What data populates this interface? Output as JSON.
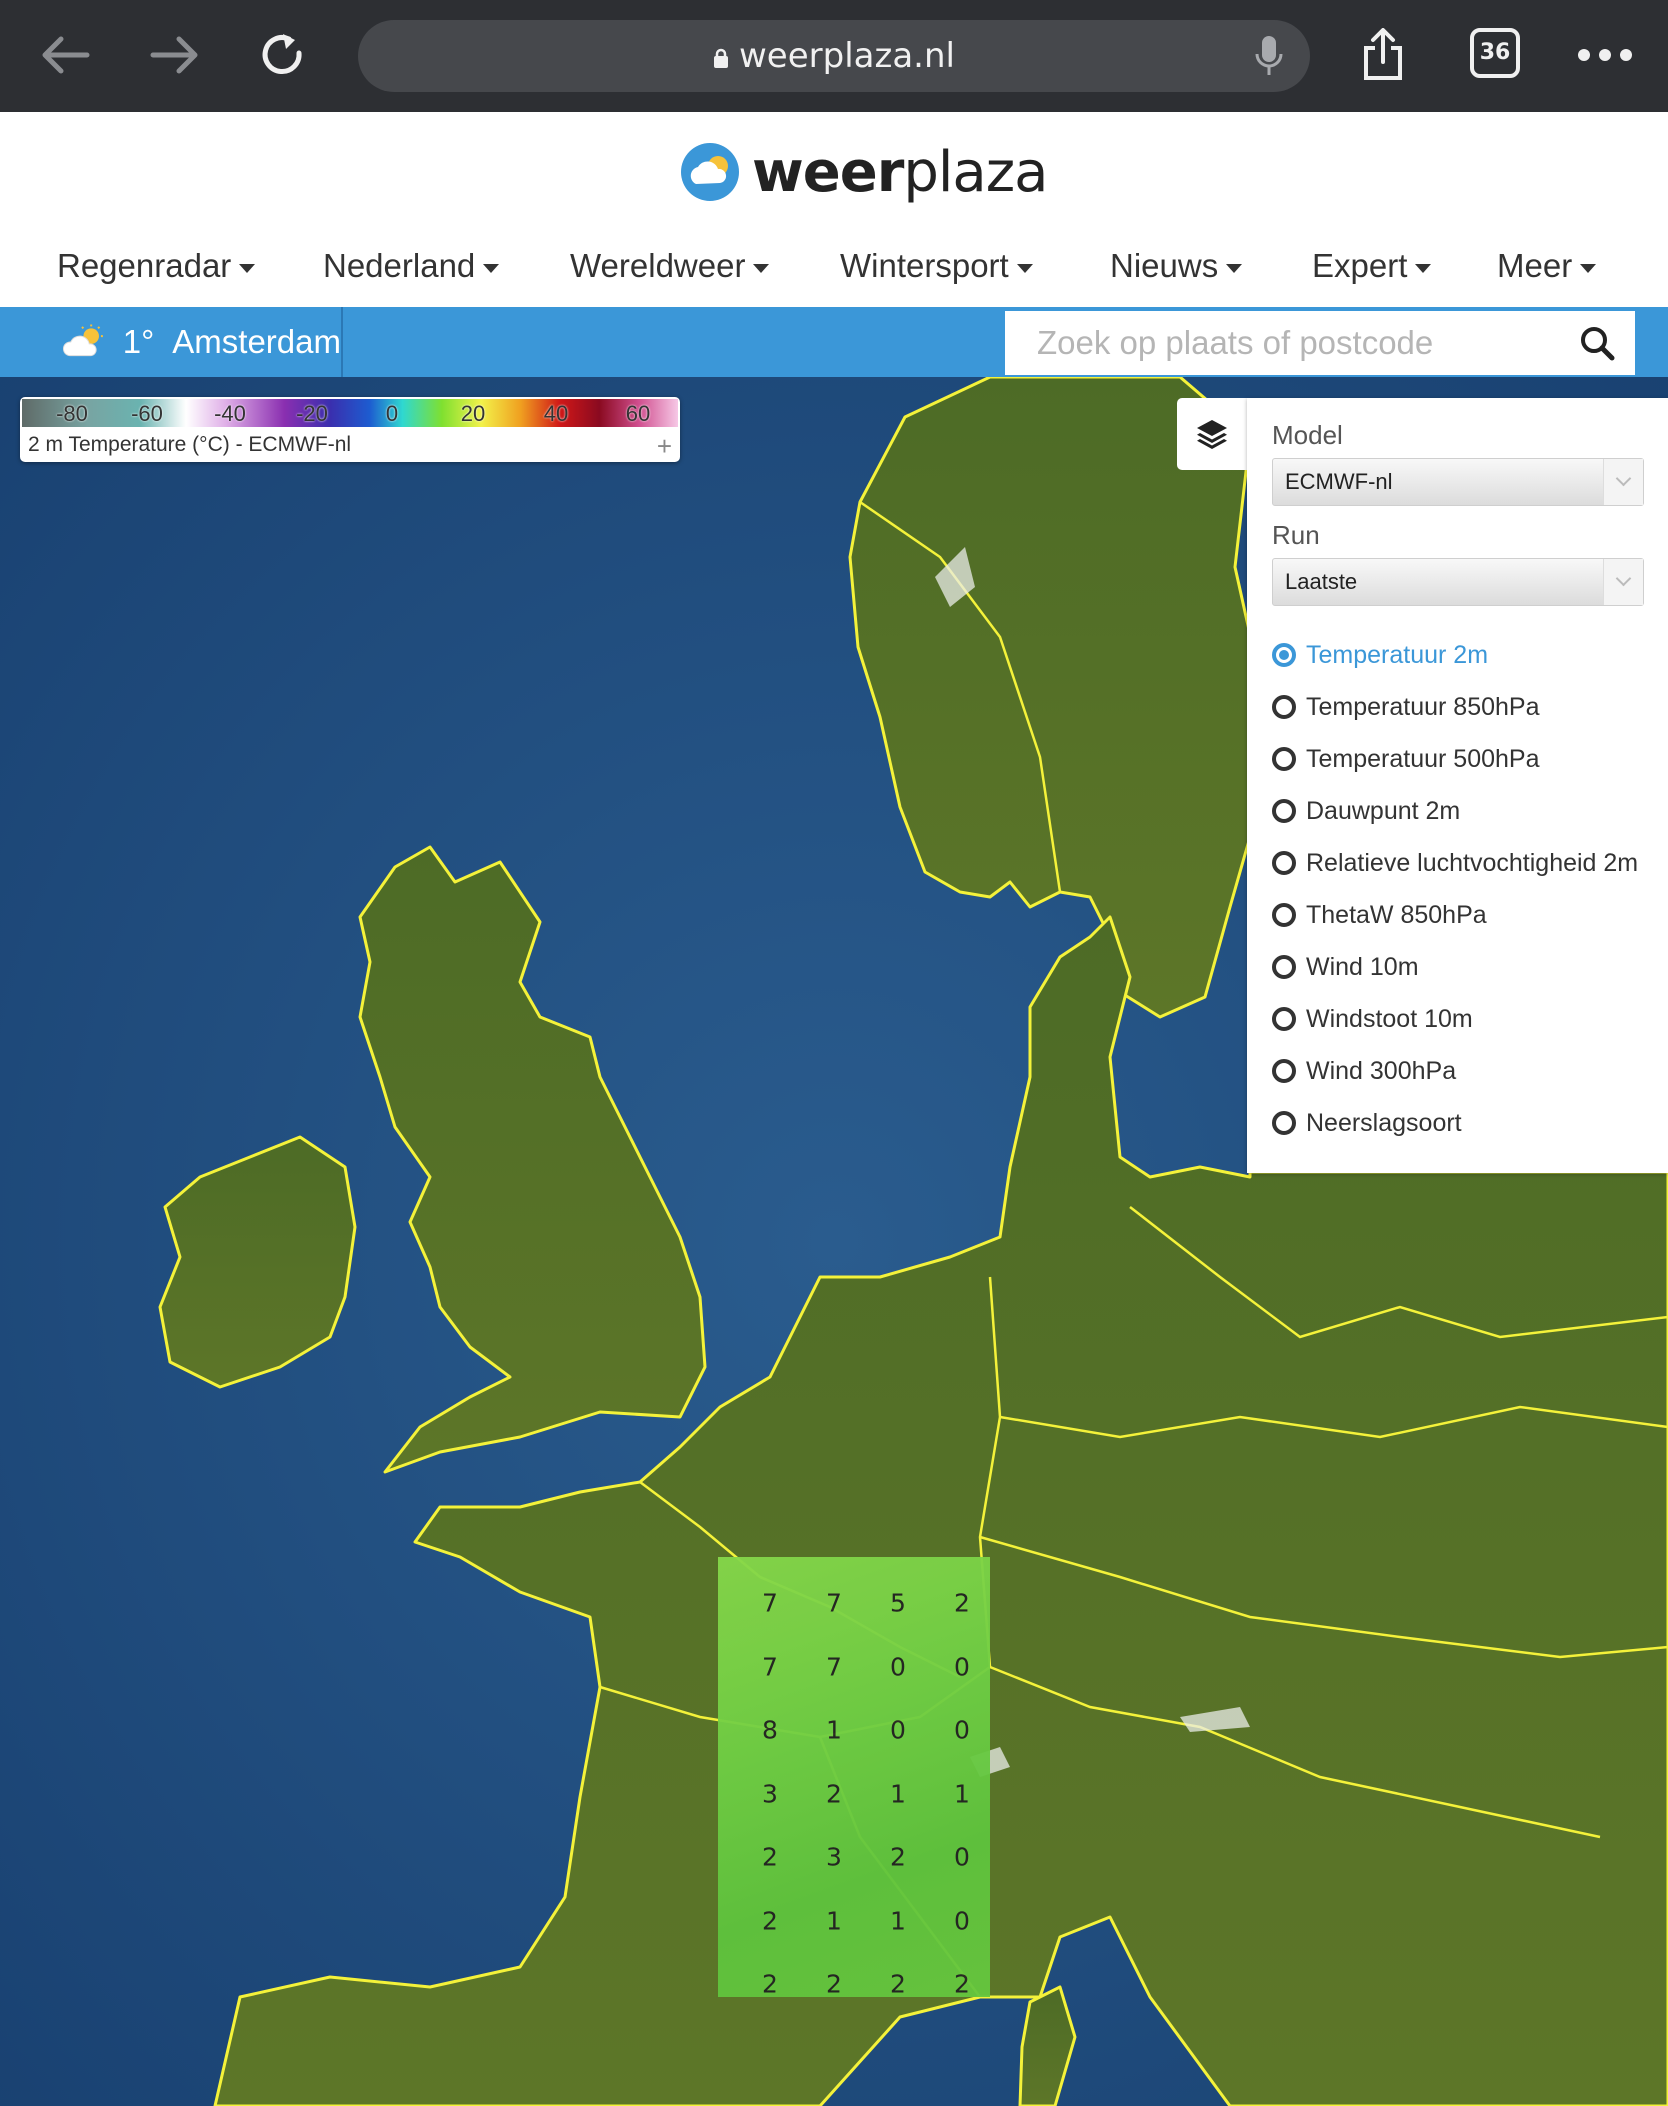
{
  "browser": {
    "url": "weerplaza.nl",
    "tab_count": "36",
    "icons": [
      "back-arrow-icon",
      "forward-arrow-icon",
      "reload-icon",
      "lock-icon",
      "mic-icon",
      "share-icon",
      "tabs-icon",
      "more-dots-icon"
    ]
  },
  "site": {
    "logo_text_bold": "weer",
    "logo_text_light": "plaza",
    "nav": [
      {
        "label": "Regenradar"
      },
      {
        "label": "Nederland"
      },
      {
        "label": "Wereldweer"
      },
      {
        "label": "Wintersport"
      },
      {
        "label": "Nieuws"
      },
      {
        "label": "Expert"
      },
      {
        "label": "Meer"
      }
    ],
    "location": {
      "temperature": "1°",
      "city": "Amsterdam",
      "weather_icon": "partly-cloudy-icon"
    },
    "search": {
      "placeholder": "Zoek op plaats of postcode",
      "value": ""
    },
    "colors": {
      "accent_blue": "#3b97d8",
      "map_borders": "#f4f23a"
    }
  },
  "legend": {
    "ticks": [
      "-80",
      "-60",
      "-40",
      "-20",
      "0",
      "20",
      "40",
      "60"
    ],
    "title": "2 m Temperature (°C) - ECMWF-nl",
    "expand": "+"
  },
  "panel": {
    "model_label": "Model",
    "model_value": "ECMWF-nl",
    "run_label": "Run",
    "run_value": "Laatste",
    "layers": [
      {
        "label": "Temperatuur 2m",
        "selected": true
      },
      {
        "label": "Temperatuur 850hPa",
        "selected": false
      },
      {
        "label": "Temperatuur 500hPa",
        "selected": false
      },
      {
        "label": "Dauwpunt 2m",
        "selected": false
      },
      {
        "label": "Relatieve luchtvochtigheid 2m",
        "selected": false
      },
      {
        "label": "ThetaW 850hPa",
        "selected": false
      },
      {
        "label": "Wind 10m",
        "selected": false
      },
      {
        "label": "Windstoot 10m",
        "selected": false
      },
      {
        "label": "Wind 300hPa",
        "selected": false
      },
      {
        "label": "Neerslagsoort",
        "selected": false
      }
    ]
  },
  "temperature_grid": {
    "rows": [
      [
        "7",
        "7",
        "5",
        "2"
      ],
      [
        "7",
        "7",
        "0",
        "0"
      ],
      [
        "8",
        "1",
        "0",
        "0"
      ],
      [
        "3",
        "2",
        "1",
        "1"
      ],
      [
        "2",
        "3",
        "2",
        "0"
      ],
      [
        "2",
        "1",
        "1",
        "0"
      ],
      [
        "2",
        "2",
        "2",
        "2"
      ]
    ]
  }
}
